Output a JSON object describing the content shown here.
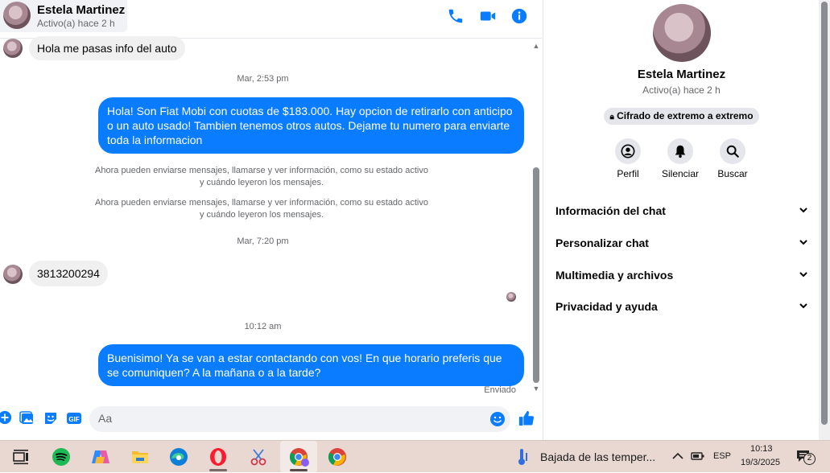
{
  "contact": {
    "name": "Estela Martinez",
    "status": "Activo(a) hace 2 h"
  },
  "messages": {
    "incoming_1": "Hola me pasas info del auto",
    "time_1": "Mar, 2:53 pm",
    "outgoing_1": "Hola! Son Fiat Mobi con cuotas de $183.000. Hay opcion de retirarlo con anticipo o un auto usado! Tambien tenemos otros autos. Dejame tu numero para enviarte toda la informacion",
    "system_1_line1": "Ahora pueden enviarse mensajes, llamarse y ver información, como su estado activo",
    "system_1_line2": "y cuándo leyeron los mensajes.",
    "system_2_line1": "Ahora pueden enviarse mensajes, llamarse y ver información, como su estado activo",
    "system_2_line2": "y cuándo leyeron los mensajes.",
    "time_2": "Mar, 7:20 pm",
    "incoming_2": "3813200294",
    "time_3": "10:12 am",
    "outgoing_2": "Buenisimo! Ya se van a estar contactando con vos! En que horario preferis que se comuniquen? A la mañana o a la tarde?",
    "sent_status": "Enviado"
  },
  "composer": {
    "placeholder": "Aa"
  },
  "side_panel": {
    "encryption_label": "Cifrado de extremo a extremo",
    "actions": [
      {
        "label": "Perfil",
        "icon": "profile-icon"
      },
      {
        "label": "Silenciar",
        "icon": "bell-icon"
      },
      {
        "label": "Buscar",
        "icon": "search-icon"
      }
    ],
    "sections": [
      {
        "label": "Información del chat"
      },
      {
        "label": "Personalizar chat"
      },
      {
        "label": "Multimedia y archivos"
      },
      {
        "label": "Privacidad y ayuda"
      }
    ]
  },
  "taskbar": {
    "weather_text": "Bajada de las temper...",
    "language": "ESP",
    "time": "10:13",
    "date": "19/3/2025",
    "notification_count": "2"
  },
  "colors": {
    "accent": "#0a7cff",
    "taskbar": "#e9d8d2"
  }
}
